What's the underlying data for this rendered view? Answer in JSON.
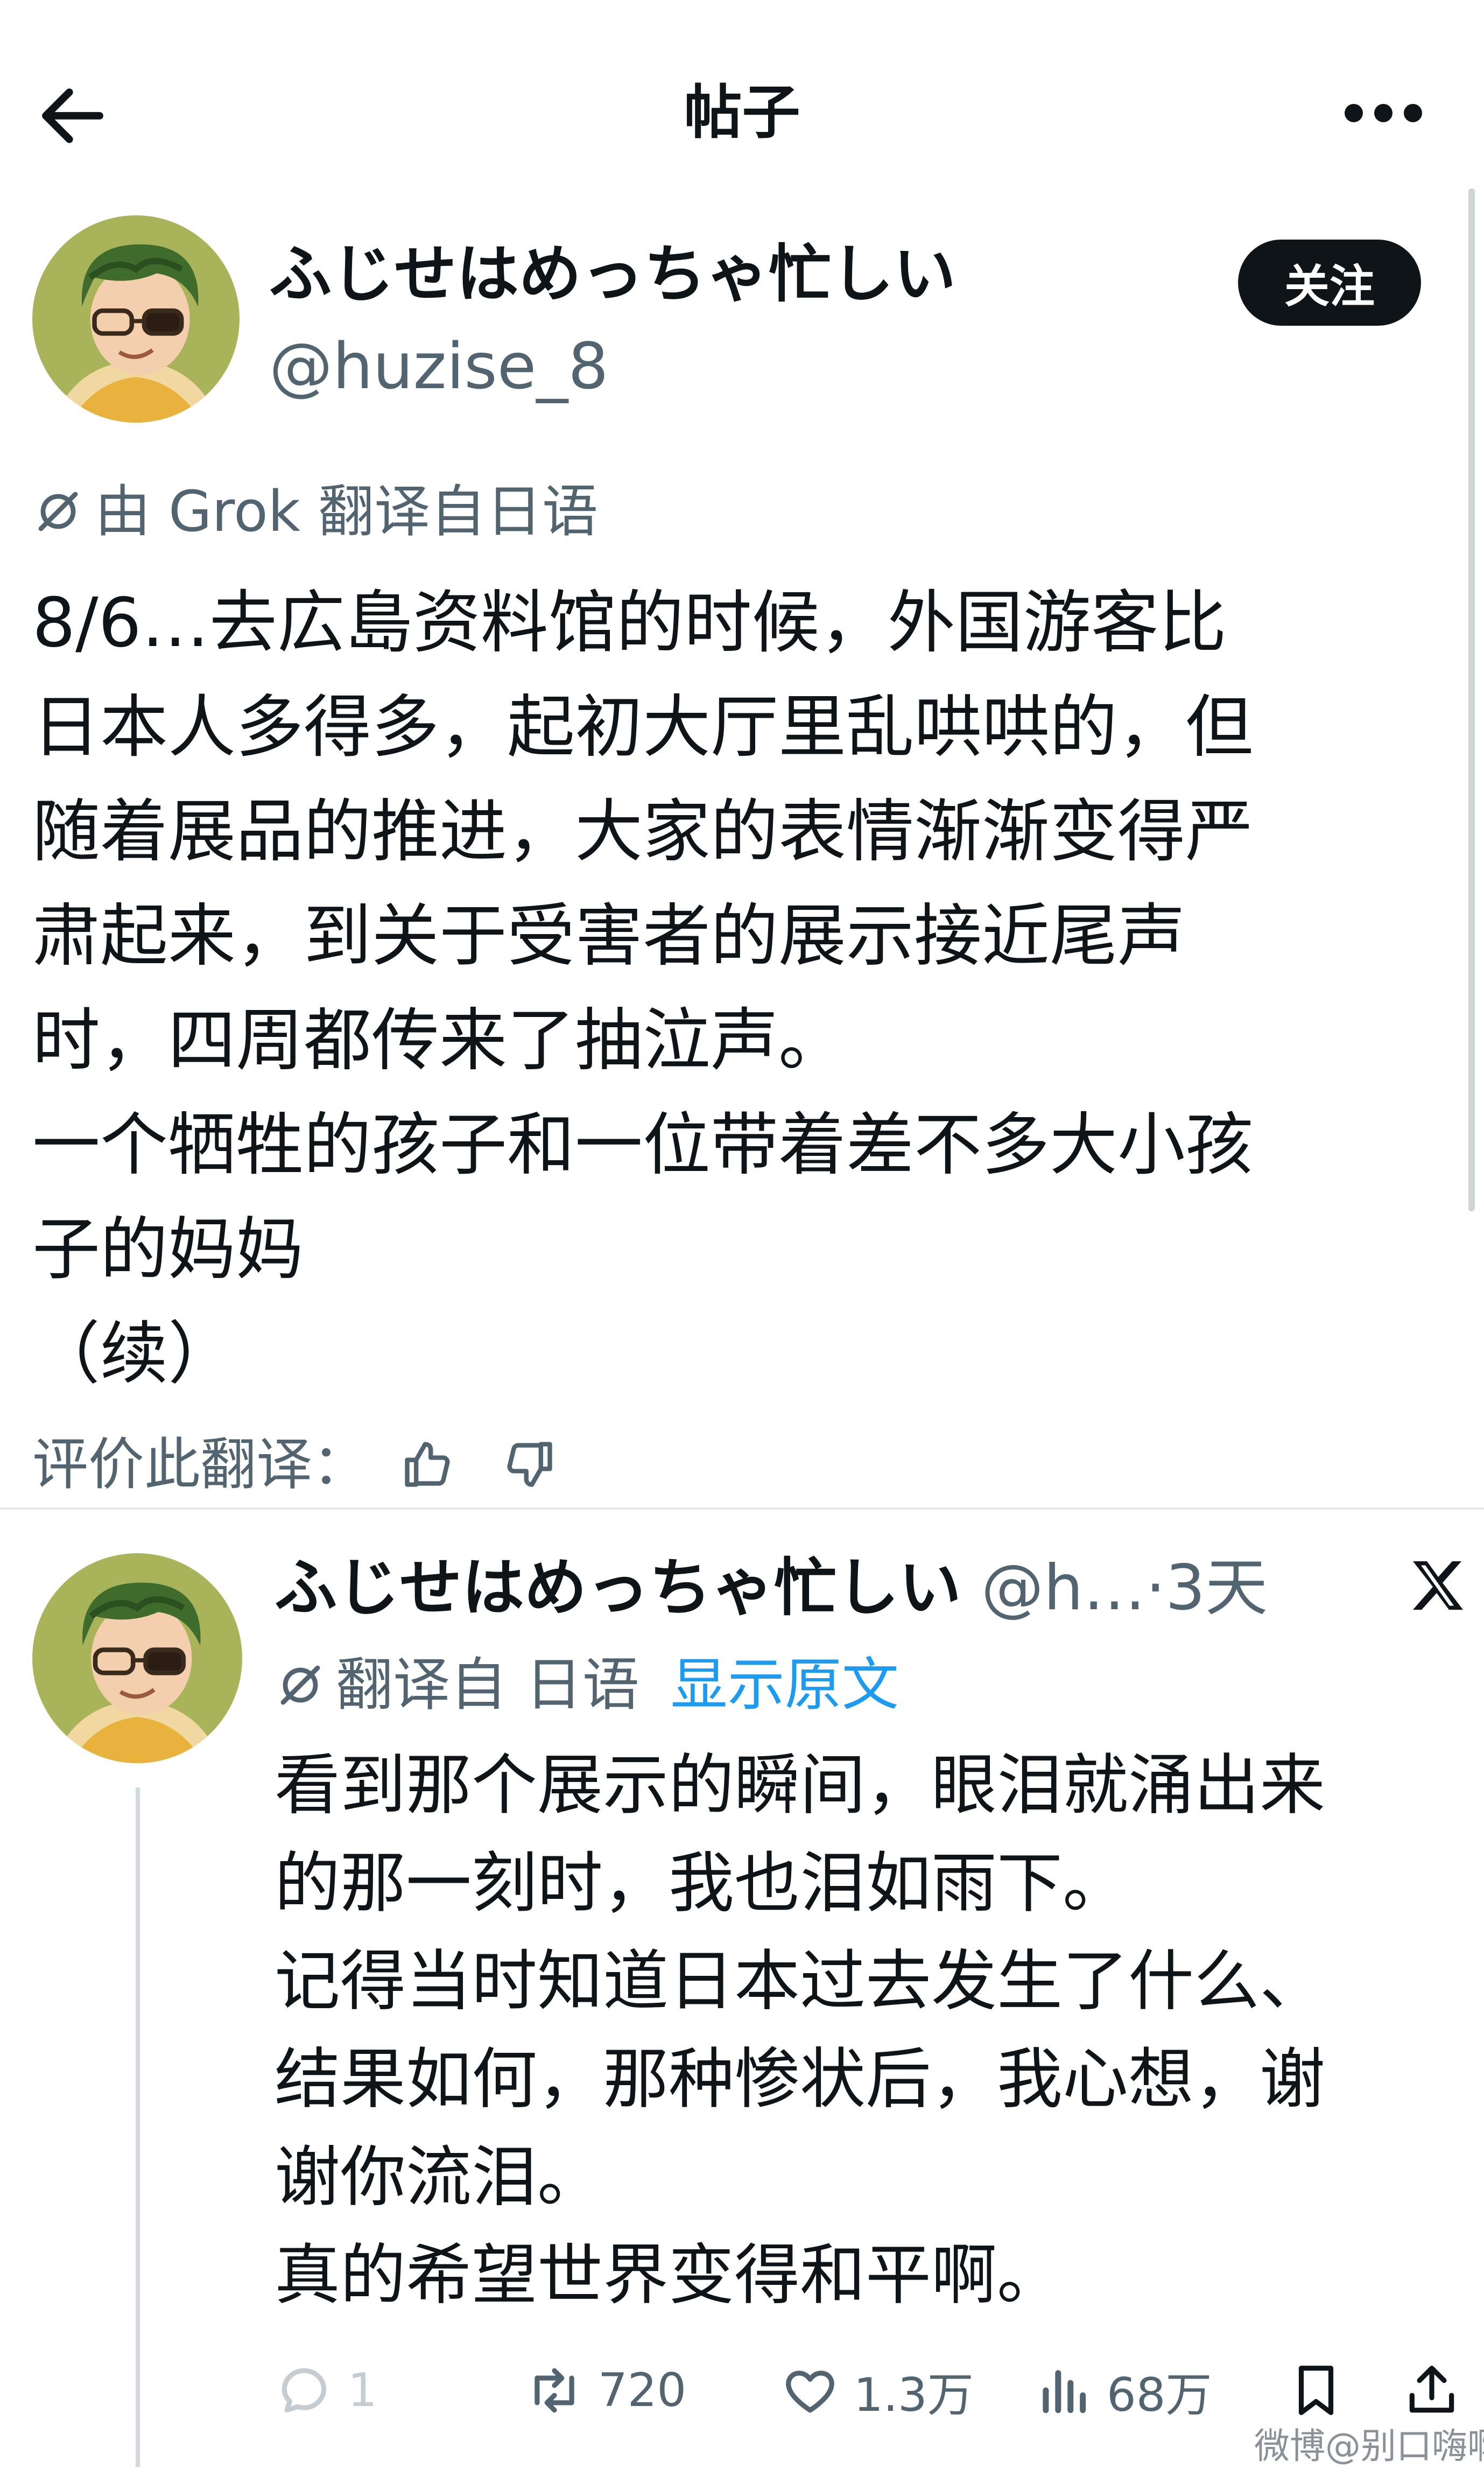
{
  "header": {
    "title": "帖子",
    "back_icon": "arrow-left-icon",
    "more_icon": "more-horizontal-icon"
  },
  "post": {
    "author_name": "ふじせはめっちゃ忙しい",
    "author_handle": "@huzise_8",
    "follow_label": "关注",
    "translation_label": "由 Grok 翻译自日语",
    "body_lines": [
      "8/6…去広島资料馆的时候，外国游客比",
      "日本人多得多，起初大厅里乱哄哄的，但",
      "随着展品的推进，大家的表情渐渐变得严",
      "肃起来，到关于受害者的展示接近尾声",
      "时，四周都传来了抽泣声。",
      "一个牺牲的孩子和一位带着差不多大小孩",
      "子的妈妈",
      "（续）"
    ],
    "rate_label": "评价此翻译："
  },
  "reply": {
    "author_name": "ふじせはめっちゃ忙しい",
    "handle": "@h…",
    "time": "3天",
    "translation_prefix": "翻译自 日语",
    "show_original": "显示原文",
    "body_lines": [
      "看到那个展示的瞬间，眼泪就涌出来",
      "的那一刻时，我也泪如雨下。",
      "记得当时知道日本过去发生了什么、",
      "结果如何，那种惨状后，我心想，谢",
      "谢你流泪。",
      "真的希望世界变得和平啊。"
    ],
    "actions": {
      "reply_count": "1",
      "retweet_count": "720",
      "like_count": "1.3万",
      "view_count": "68万"
    }
  },
  "watermark": "微博@别口嗨啊",
  "colors": {
    "text": "#0f1419",
    "secondary": "#536471",
    "link": "#1d9bf0",
    "button_bg": "#0f1419"
  }
}
